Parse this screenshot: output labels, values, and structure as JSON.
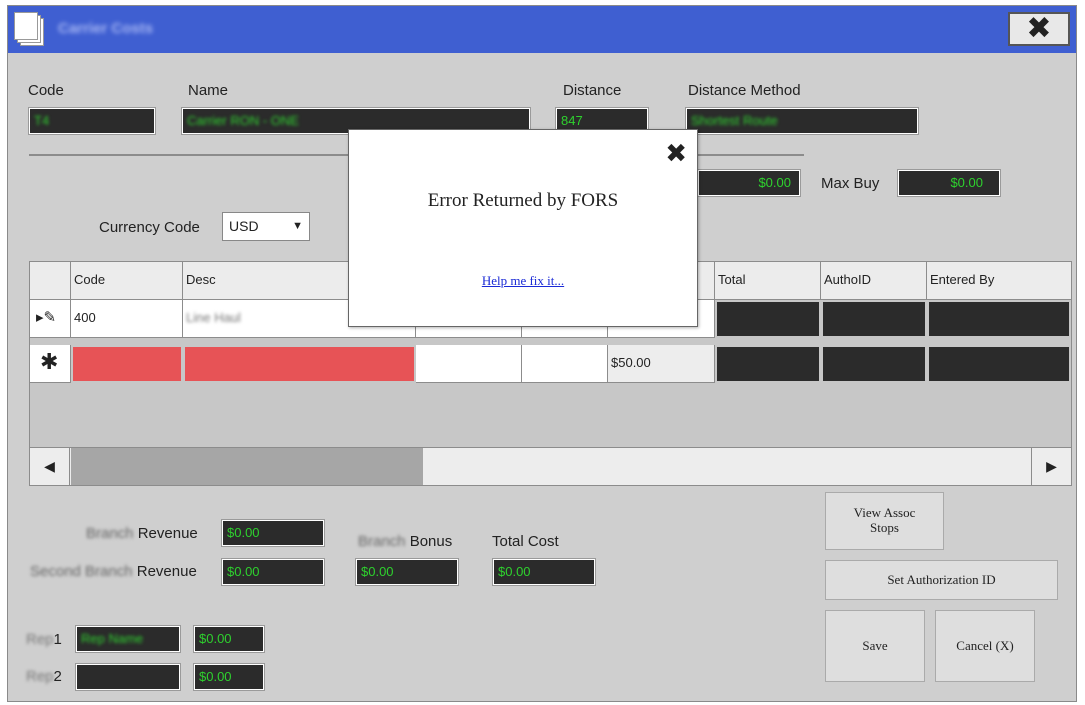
{
  "window": {
    "title": "Carrier Costs"
  },
  "header_fields": {
    "code_label": "Code",
    "code_value": "T4",
    "name_label": "Name",
    "name_value": "Carrier RON - ONE",
    "distance_label": "Distance",
    "distance_value": "847",
    "method_label": "Distance Method",
    "method_value": "Shortest Route"
  },
  "buy": {
    "min_value": "$0.00",
    "max_label": "Max Buy",
    "max_value": "$0.00"
  },
  "currency": {
    "label": "Currency Code",
    "value": "USD"
  },
  "grid": {
    "columns": [
      "",
      "Code",
      "Desc",
      "",
      "",
      "",
      "Total",
      "AuthoID",
      "Entered By"
    ],
    "row1": {
      "code": "400",
      "desc": "Line Haul"
    },
    "row2": {
      "amount": "$50.00"
    }
  },
  "summary": {
    "branch_revenue_label": "Revenue",
    "branch_revenue_label_prefix": "Branch",
    "branch_revenue_value": "$0.00",
    "second_revenue_label": "Revenue",
    "second_revenue_label_prefix": "Second Branch",
    "second_revenue_value": "$0.00",
    "bonus_label": "Bonus",
    "bonus_label_prefix": "Branch",
    "bonus_value": "$0.00",
    "total_cost_label": "Total Cost",
    "total_cost_value": "$0.00",
    "rep1_label": "1",
    "rep1_label_prefix": "Rep",
    "rep1_name": "Rep Name",
    "rep1_value": "$0.00",
    "rep2_label": "2",
    "rep2_label_prefix": "Rep",
    "rep2_name": "",
    "rep2_value": "$0.00"
  },
  "buttons": {
    "view_assoc": "View Assoc Stops",
    "set_auth": "Set Authorization ID",
    "save": "Save",
    "cancel": "Cancel (X)"
  },
  "modal": {
    "message": "Error Returned by FORS",
    "link": "Help me fix it..."
  }
}
